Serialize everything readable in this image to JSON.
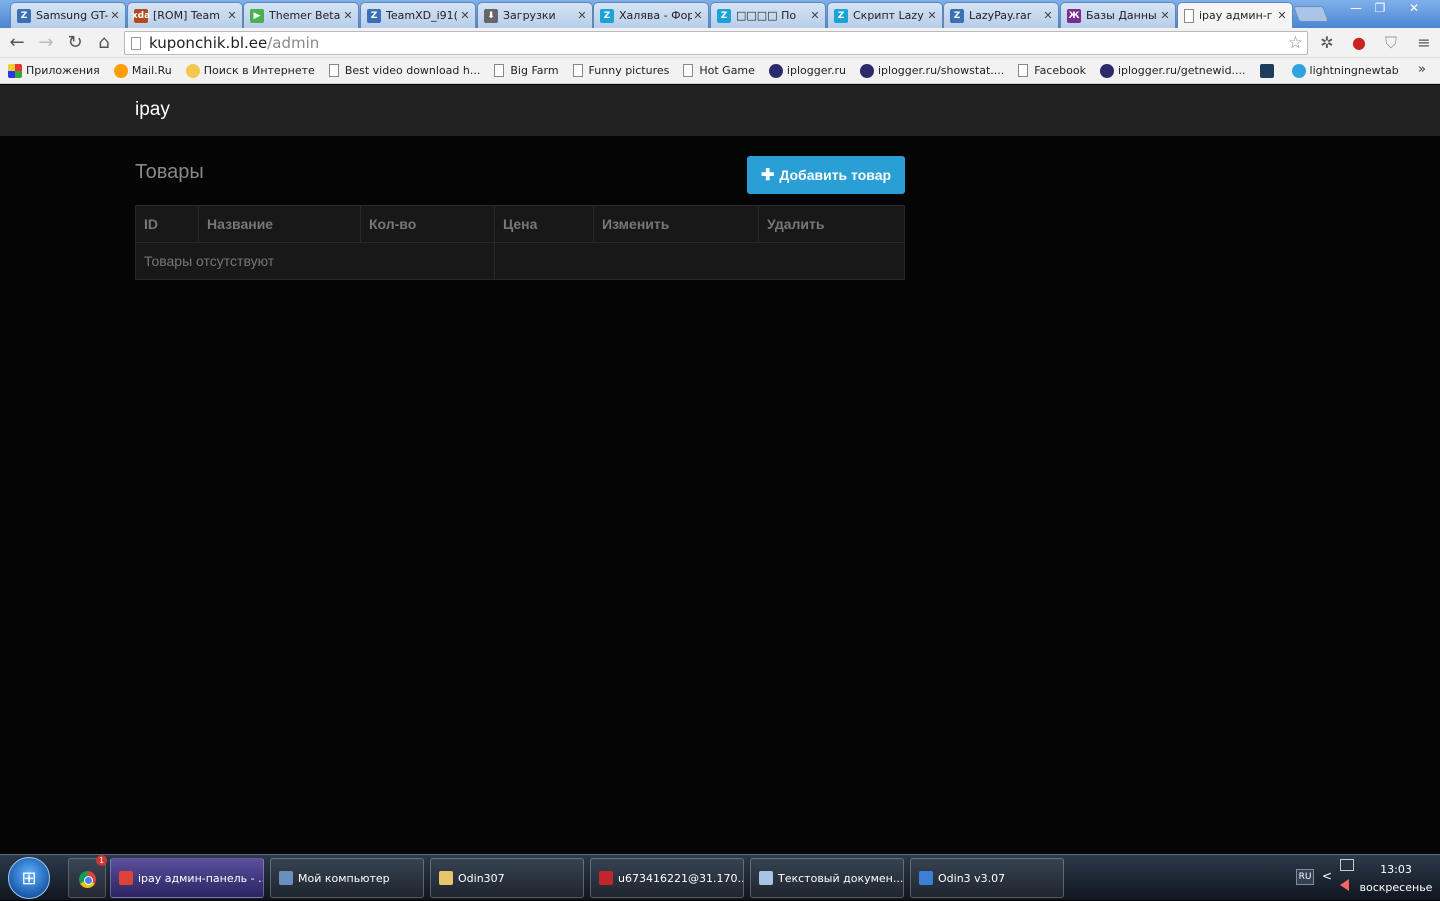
{
  "browser": {
    "tabs": [
      {
        "title": "Samsung GT-",
        "icon_color": "#3b6fb6",
        "icon_text": "Z"
      },
      {
        "title": "[ROM] Team",
        "icon_color": "#b24a1e",
        "icon_text": "xda"
      },
      {
        "title": "Themer Beta",
        "icon_color": "#4caf50",
        "icon_text": "▶"
      },
      {
        "title": "TeamXD_i91(",
        "icon_color": "#3b6fb6",
        "icon_text": "Z"
      },
      {
        "title": "Загрузки",
        "icon_color": "#666666",
        "icon_text": "⬇"
      },
      {
        "title": "Халява - Фор",
        "icon_color": "#1aa3d6",
        "icon_text": "Z"
      },
      {
        "title": "□□□□ По",
        "icon_color": "#1aa3d6",
        "icon_text": "Z"
      },
      {
        "title": "Скрипт Lazy",
        "icon_color": "#1aa3d6",
        "icon_text": "Z"
      },
      {
        "title": "LazyPay.rar",
        "icon_color": "#3b6fb6",
        "icon_text": "Z"
      },
      {
        "title": "Базы Данны",
        "icon_color": "#7a2d8e",
        "icon_text": "Ж"
      },
      {
        "title": "ipay админ-г",
        "icon_color": "#ffffff",
        "icon_text": ""
      }
    ],
    "close_glyph": "✕",
    "window_buttons": {
      "minimize": "—",
      "maximize": "❐",
      "close": "✕"
    },
    "nav": {
      "back": "←",
      "forward": "→",
      "reload": "↻",
      "home": "⌂"
    },
    "url_host": "kuponchik.bl.ee",
    "url_path": "/admin",
    "star": "☆",
    "menu": "≡",
    "bookmarks": [
      {
        "label": "Приложения",
        "icon": "apps-icon"
      },
      {
        "label": "Mail.Ru",
        "icon": "mailru-icon"
      },
      {
        "label": "Поиск в Интернете",
        "icon": "search-icon"
      },
      {
        "label": "Best video download h...",
        "icon": "page-icon"
      },
      {
        "label": "Big Farm",
        "icon": "page-icon"
      },
      {
        "label": "Funny pictures",
        "icon": "page-icon"
      },
      {
        "label": "Hot Game",
        "icon": "page-icon"
      },
      {
        "label": "iplogger.ru",
        "icon": "iplogger-icon"
      },
      {
        "label": "iplogger.ru/showstat....",
        "icon": "iplogger-icon"
      },
      {
        "label": "Facebook",
        "icon": "page-icon"
      },
      {
        "label": "iplogger.ru/getnewid....",
        "icon": "iplogger-icon"
      },
      {
        "label": "",
        "icon": "v-icon"
      },
      {
        "label": "lightningnewtab",
        "icon": "lightning-icon"
      }
    ],
    "bookmarks_more": "»"
  },
  "app": {
    "brand": "ipay",
    "page_title": "Товары",
    "add_button": "Добавить товар",
    "add_plus": "✚",
    "table": {
      "headers": [
        "ID",
        "Название",
        "Кол-во",
        "Цена",
        "Изменить",
        "Удалить"
      ],
      "empty_message": "Товары отсутствуют"
    }
  },
  "taskbar": {
    "start": "⊞",
    "notification_count": "1",
    "tasks": [
      {
        "label": "ipay админ-панель - ...",
        "icon_color": "#db4437"
      },
      {
        "label": "Мой компьютер",
        "icon_color": "#6a8fbe"
      },
      {
        "label": "Odin307",
        "icon_color": "#e7c66b"
      },
      {
        "label": "u673416221@31.170....",
        "icon_color": "#c0272d"
      },
      {
        "label": "Текстовый докумен...",
        "icon_color": "#a7c4e5"
      },
      {
        "label": "Odin3 v3.07",
        "icon_color": "#3b7fd6"
      }
    ],
    "lang": "RU",
    "tray_arrow": "<",
    "time": "13:03",
    "day": "воскресенье"
  }
}
